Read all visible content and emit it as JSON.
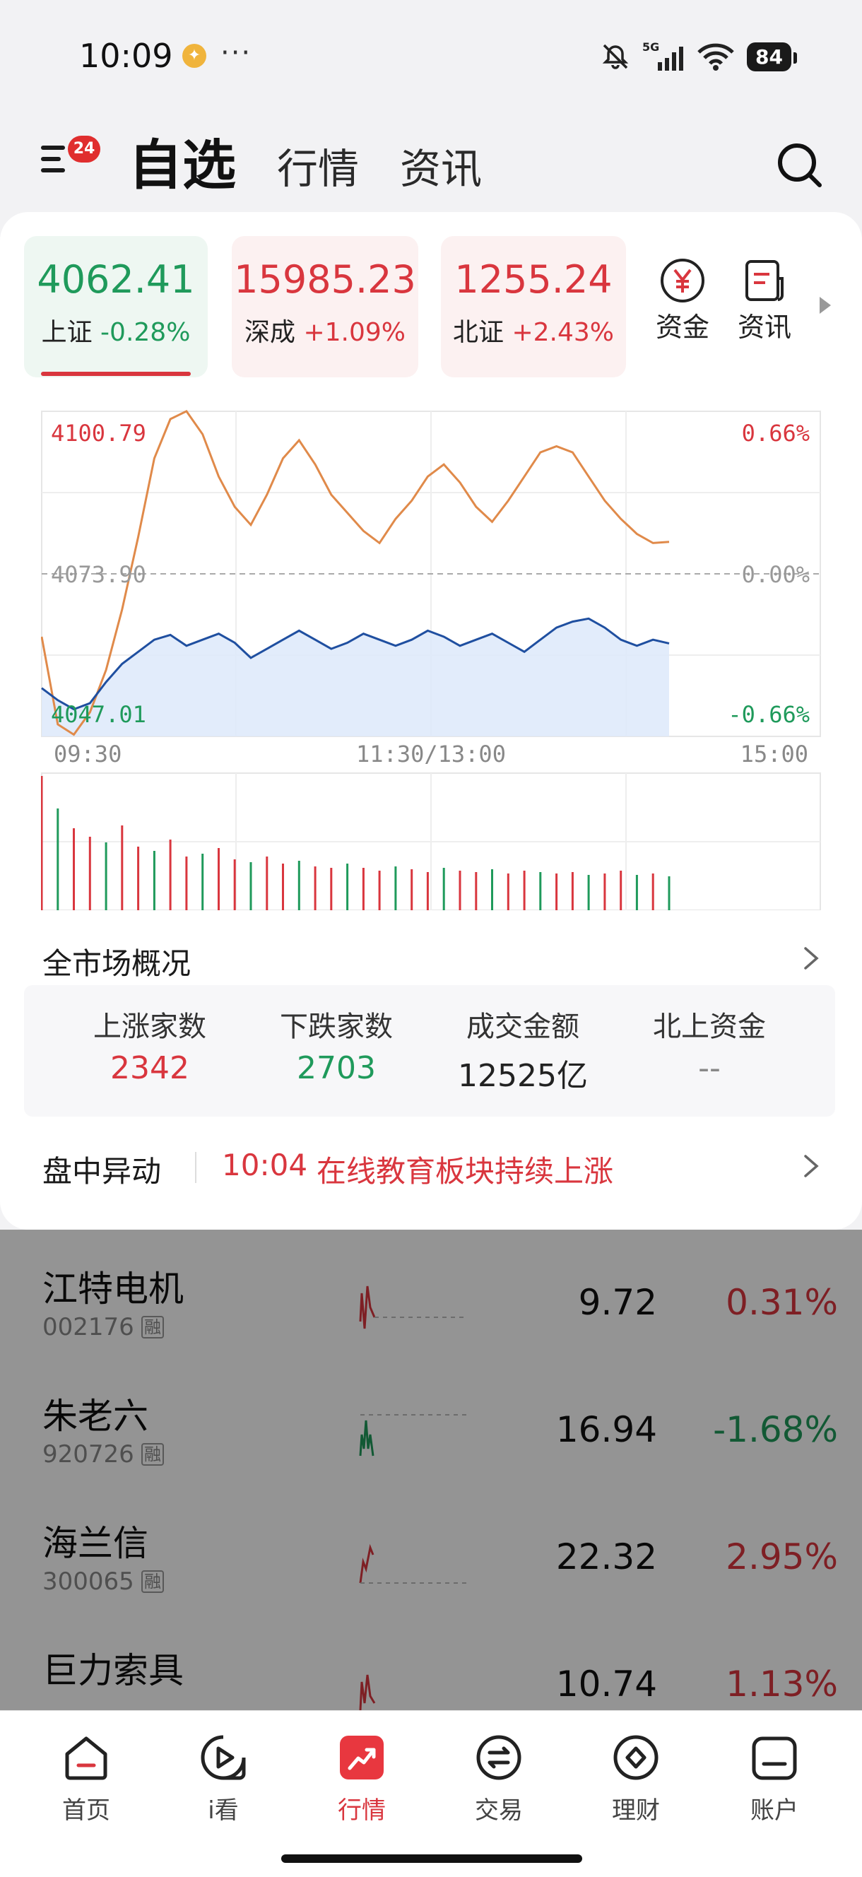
{
  "status_bar": {
    "time": "10:09",
    "more": "···",
    "network": "5G",
    "battery": "84"
  },
  "header": {
    "menu_badge": "24",
    "tabs": [
      "自选",
      "行情",
      "资讯"
    ],
    "active_tab": "自选"
  },
  "indices": [
    {
      "value": "4062.41",
      "name": "上证",
      "change": "-0.28%",
      "color": "#1f9a5b",
      "selected": true
    },
    {
      "value": "15985.23",
      "name": "深成",
      "change": "+1.09%",
      "color": "#d9363e"
    },
    {
      "value": "1255.24",
      "name": "北证",
      "change": "+2.43%",
      "color": "#d9363e"
    }
  ],
  "quick_buttons": [
    {
      "label": "资金",
      "icon": "yuan-icon"
    },
    {
      "label": "资讯",
      "icon": "news-icon"
    }
  ],
  "chart_labels": {
    "high": "4100.79",
    "mid": "4073.90",
    "low": "4047.01",
    "high_pct": "0.66%",
    "mid_pct": "0.00%",
    "low_pct": "-0.66%",
    "t_open": "09:30",
    "t_mid": "11:30/13:00",
    "t_close": "15:00"
  },
  "chart_data": {
    "type": "line",
    "x_range": [
      "09:30",
      "15:00"
    ],
    "ylim": [
      4047.01,
      4100.79
    ],
    "baseline": 4073.9,
    "series": [
      {
        "color": "#e08a4a",
        "x": [
          0,
          1,
          2,
          3,
          4,
          5,
          6,
          7,
          8,
          9,
          10,
          11,
          12,
          13,
          14,
          15,
          16,
          17,
          18,
          19,
          20,
          21,
          22,
          23,
          24,
          25,
          26,
          27,
          28,
          29,
          30,
          31,
          32,
          33,
          34,
          35,
          36,
          37,
          38,
          39
        ],
        "values": [
          4063.5,
          4049.0,
          4047.3,
          4051.0,
          4058.0,
          4068.0,
          4080.0,
          4093.0,
          4099.5,
          4100.8,
          4097.0,
          4090.0,
          4085.0,
          4082.0,
          4087.0,
          4093.0,
          4096.0,
          4092.0,
          4087.0,
          4084.0,
          4081.0,
          4079.0,
          4083.0,
          4086.0,
          4090.0,
          4092.0,
          4089.0,
          4085.0,
          4082.5,
          4086.0,
          4090.0,
          4094.0,
          4095.0,
          4094.0,
          4090.0,
          4086.0,
          4083.0,
          4080.5,
          4079.0,
          4079.2
        ]
      },
      {
        "color": "#1f4fa0",
        "x": [
          0,
          1,
          2,
          3,
          4,
          5,
          6,
          7,
          8,
          9,
          10,
          11,
          12,
          13,
          14,
          15,
          16,
          17,
          18,
          19,
          20,
          21,
          22,
          23,
          24,
          25,
          26,
          27,
          28,
          29,
          30,
          31,
          32,
          33,
          34,
          35,
          36,
          37,
          38,
          39
        ],
        "values": [
          4055.0,
          4053.0,
          4051.5,
          4052.5,
          4056.0,
          4059.0,
          4061.0,
          4063.0,
          4063.8,
          4062.0,
          4063.0,
          4064.0,
          4062.5,
          4060.0,
          4061.5,
          4063.0,
          4064.5,
          4063.0,
          4061.5,
          4062.5,
          4064.0,
          4063.0,
          4062.0,
          4063.0,
          4064.5,
          4063.5,
          4062.0,
          4063.0,
          4064.0,
          4062.5,
          4061.0,
          4063.0,
          4065.0,
          4066.0,
          4066.5,
          4065.0,
          4063.0,
          4062.0,
          4063.0,
          4062.4
        ]
      }
    ],
    "volume": [
      95,
      72,
      58,
      52,
      48,
      60,
      45,
      42,
      50,
      38,
      40,
      44,
      36,
      34,
      38,
      33,
      35,
      31,
      30,
      33,
      30,
      28,
      31,
      29,
      27,
      30,
      28,
      27,
      29,
      26,
      28,
      27,
      26,
      27,
      25,
      26,
      28,
      25,
      26,
      24
    ],
    "volume_colors": [
      "#d9363e",
      "#1f9a5b",
      "#d9363e",
      "#d9363e",
      "#1f9a5b",
      "#d9363e",
      "#d9363e",
      "#1f9a5b",
      "#d9363e",
      "#d9363e",
      "#1f9a5b",
      "#d9363e",
      "#d9363e",
      "#1f9a5b",
      "#d9363e",
      "#d9363e",
      "#1f9a5b",
      "#d9363e",
      "#d9363e",
      "#1f9a5b",
      "#d9363e",
      "#d9363e",
      "#1f9a5b",
      "#d9363e",
      "#d9363e",
      "#1f9a5b",
      "#d9363e",
      "#d9363e",
      "#1f9a5b",
      "#d9363e",
      "#d9363e",
      "#1f9a5b",
      "#d9363e",
      "#d9363e",
      "#1f9a5b",
      "#d9363e",
      "#d9363e",
      "#1f9a5b",
      "#d9363e",
      "#1f9a5b"
    ]
  },
  "overview": {
    "title": "全市场概况",
    "columns": [
      {
        "label": "上涨家数",
        "value": "2342",
        "color": "#d9363e"
      },
      {
        "label": "下跌家数",
        "value": "2703",
        "color": "#1f9a5b"
      },
      {
        "label": "成交金额",
        "value": "12525亿",
        "color": "#222222"
      },
      {
        "label": "北上资金",
        "value": "--",
        "color": "#888888"
      }
    ]
  },
  "alert": {
    "title": "盘中异动",
    "time": "10:04",
    "text": "在线教育板块持续上涨"
  },
  "stocks": [
    {
      "name": "江特电机",
      "code": "002176",
      "tag": "融",
      "price": "9.72",
      "pct": "0.31%",
      "color": "#d9363e"
    },
    {
      "name": "朱老六",
      "code": "920726",
      "tag": "融",
      "price": "16.94",
      "pct": "-1.68%",
      "color": "#1f9a5b"
    },
    {
      "name": "海兰信",
      "code": "300065",
      "tag": "融",
      "price": "22.32",
      "pct": "2.95%",
      "color": "#d9363e"
    },
    {
      "name": "巨力索具",
      "code": "",
      "tag": "",
      "price": "10.74",
      "pct": "1.13%",
      "color": "#d9363e"
    }
  ],
  "bottom_nav": [
    {
      "label": "首页",
      "icon": "home-icon"
    },
    {
      "label": "i看",
      "icon": "play-icon"
    },
    {
      "label": "行情",
      "icon": "trend-icon",
      "active": true
    },
    {
      "label": "交易",
      "icon": "exchange-icon"
    },
    {
      "label": "理财",
      "icon": "wealth-icon"
    },
    {
      "label": "账户",
      "icon": "account-icon"
    }
  ]
}
